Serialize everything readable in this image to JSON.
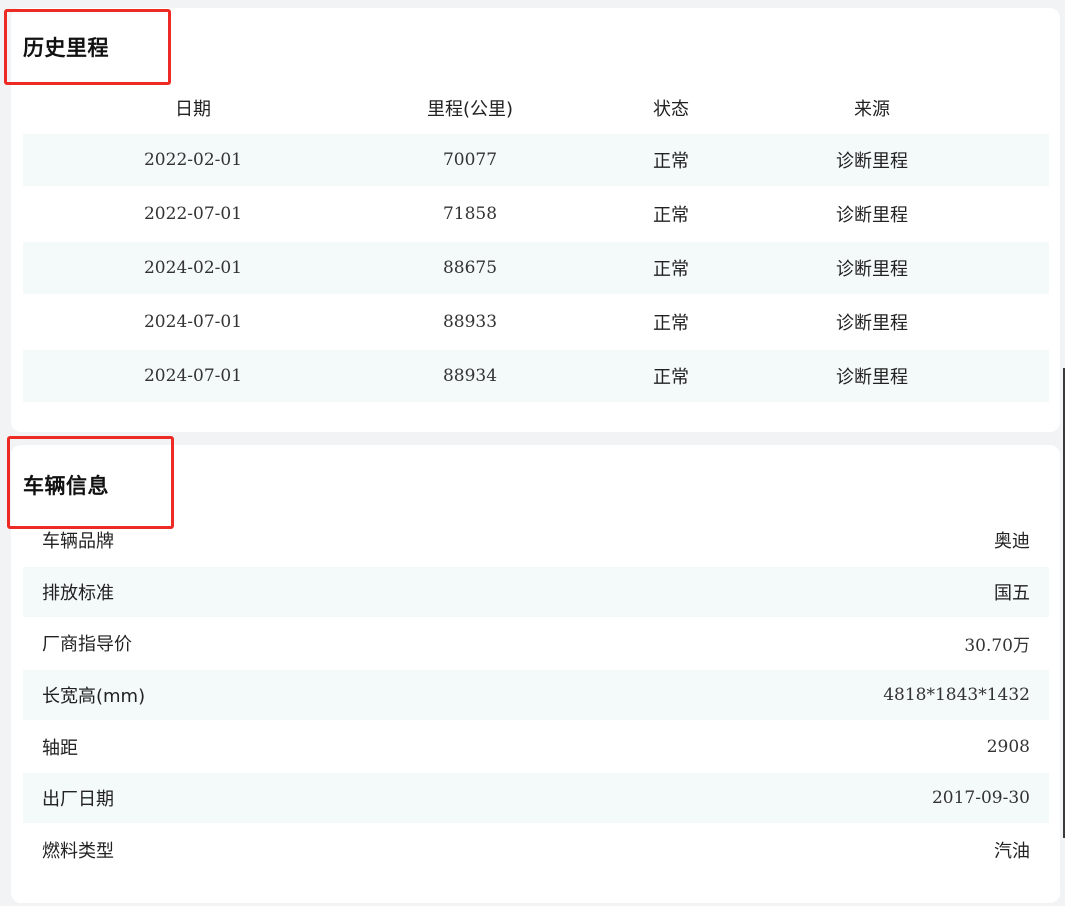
{
  "history": {
    "title": "历史里程",
    "columns": [
      "日期",
      "里程(公里)",
      "状态",
      "来源"
    ],
    "rows": [
      {
        "date": "2022-02-01",
        "mileage": "70077",
        "status": "正常",
        "source": "诊断里程"
      },
      {
        "date": "2022-07-01",
        "mileage": "71858",
        "status": "正常",
        "source": "诊断里程"
      },
      {
        "date": "2024-02-01",
        "mileage": "88675",
        "status": "正常",
        "source": "诊断里程"
      },
      {
        "date": "2024-07-01",
        "mileage": "88933",
        "status": "正常",
        "source": "诊断里程"
      },
      {
        "date": "2024-07-01",
        "mileage": "88934",
        "status": "正常",
        "source": "诊断里程"
      }
    ]
  },
  "vehicle": {
    "title": "车辆信息",
    "items": [
      {
        "label": "车辆品牌",
        "value": "奥迪"
      },
      {
        "label": "排放标准",
        "value": "国五"
      },
      {
        "label": "厂商指导价",
        "value": "30.70万"
      },
      {
        "label": "长宽高(mm)",
        "value": "4818*1843*1432"
      },
      {
        "label": "轴距",
        "value": "2908"
      },
      {
        "label": "出厂日期",
        "value": "2017-09-30"
      },
      {
        "label": "燃料类型",
        "value": "汽油"
      }
    ]
  },
  "colors": {
    "highlight": "#ee2a24",
    "stripe": "#f4f9f9",
    "page_bg": "#f2f3f4"
  }
}
